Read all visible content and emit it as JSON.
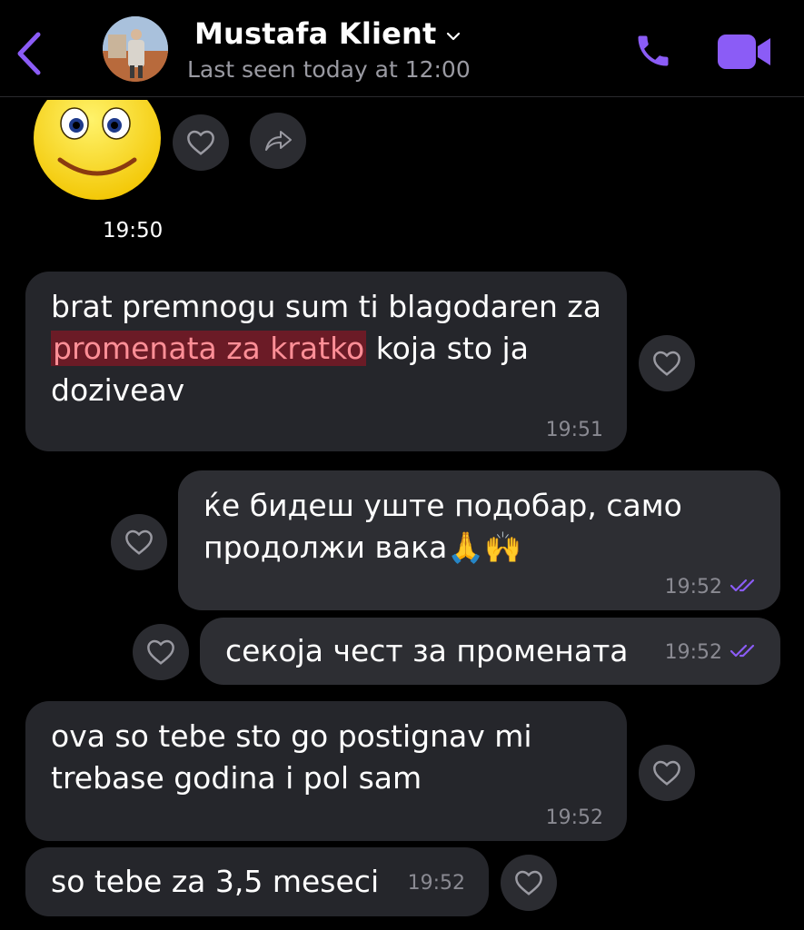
{
  "header": {
    "contact_name": "Mustafa Klient",
    "last_seen": "Last seen today at 12:00",
    "accent_color": "#8b5cf6"
  },
  "sticker": {
    "time": "19:50",
    "icon": "smiley-sticker-icon"
  },
  "messages": [
    {
      "direction": "incoming",
      "text_before": "brat premnogu sum ti blagodaren za ",
      "highlight": "promenata za kratko",
      "text_after": " koja sto ja doziveav",
      "time": "19:51"
    },
    {
      "direction": "outgoing",
      "text": "ќе бидеш уште подобар, само продолжи вака🙏🙌",
      "time": "19:52",
      "status": "read"
    },
    {
      "direction": "outgoing",
      "text": "секоја чест за промената",
      "time": "19:52",
      "status": "read"
    },
    {
      "direction": "incoming",
      "text": "ova so tebe sto go postignav mi trebase godina i pol sam",
      "time": "19:52"
    },
    {
      "direction": "incoming",
      "text": "so tebe za 3,5 meseci",
      "time": "19:52"
    }
  ]
}
